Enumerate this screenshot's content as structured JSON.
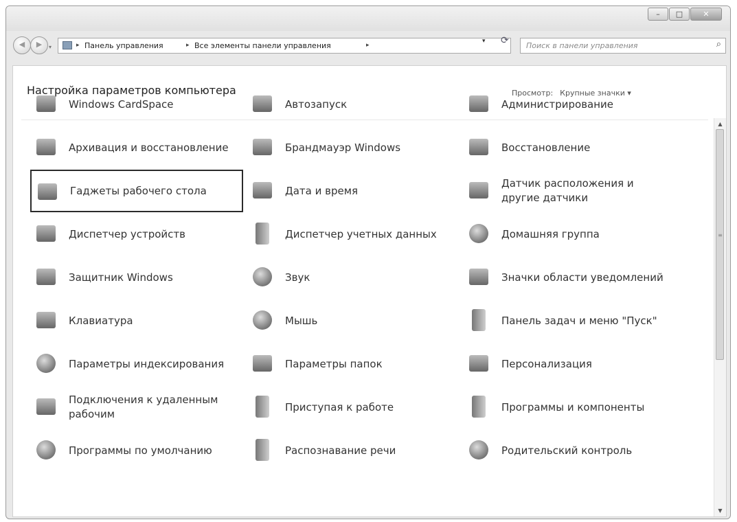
{
  "window": {
    "buttons": {
      "minimize": "–",
      "maximize": "□",
      "close": "✕"
    }
  },
  "nav": {
    "back_icon": "◀",
    "forward_icon": "▶",
    "dropdown_icon": "▾",
    "address": {
      "crumbs": [
        "Панель управления",
        "Все элементы панели управления"
      ],
      "separator": "▸",
      "dropdown_icon": "▾",
      "refresh_icon": "⟳"
    },
    "search": {
      "placeholder": "Поиск в панели управления",
      "icon": "⌕"
    }
  },
  "header": {
    "title": "Настройка параметров компьютера",
    "view_label": "Просмотр:",
    "view_value": "Крупные значки ▾"
  },
  "scrollbar": {
    "up": "▲",
    "down": "▼",
    "grip": "≡"
  },
  "items": [
    {
      "label": "Windows CardSpace",
      "icon": "cardspace-icon",
      "glyph": "sq"
    },
    {
      "label": "Автозапуск",
      "icon": "autoplay-icon",
      "glyph": "sq"
    },
    {
      "label": "Администрирование",
      "icon": "admin-tools-icon",
      "glyph": "sq"
    },
    {
      "label": "Архивация и восстановление",
      "icon": "backup-icon",
      "glyph": "sq"
    },
    {
      "label": "Брандмауэр Windows",
      "icon": "firewall-icon",
      "glyph": "sq"
    },
    {
      "label": "Восстановление",
      "icon": "recovery-icon",
      "glyph": "sq"
    },
    {
      "label": "Гаджеты рабочего стола",
      "icon": "gadgets-icon",
      "glyph": "sq",
      "selected": true
    },
    {
      "label": "Дата и время",
      "icon": "date-time-icon",
      "glyph": "sq"
    },
    {
      "label": "Датчик расположения и другие датчики",
      "icon": "sensors-icon",
      "glyph": "sq"
    },
    {
      "label": "Диспетчер устройств",
      "icon": "device-manager-icon",
      "glyph": "sq"
    },
    {
      "label": "Диспетчер учетных данных",
      "icon": "credential-manager-icon",
      "glyph": "tall"
    },
    {
      "label": "Домашняя группа",
      "icon": "homegroup-icon",
      "glyph": "rd"
    },
    {
      "label": "Защитник Windows",
      "icon": "defender-icon",
      "glyph": "sq"
    },
    {
      "label": "Звук",
      "icon": "sound-icon",
      "glyph": "rd"
    },
    {
      "label": "Значки области уведомлений",
      "icon": "notification-area-icon",
      "glyph": "sq"
    },
    {
      "label": "Клавиатура",
      "icon": "keyboard-icon",
      "glyph": "sq"
    },
    {
      "label": "Мышь",
      "icon": "mouse-icon",
      "glyph": "rd"
    },
    {
      "label": "Панель задач и меню \"Пуск\"",
      "icon": "taskbar-icon",
      "glyph": "tall"
    },
    {
      "label": "Параметры индексирования",
      "icon": "indexing-icon",
      "glyph": "rd"
    },
    {
      "label": "Параметры папок",
      "icon": "folder-options-icon",
      "glyph": "sq"
    },
    {
      "label": "Персонализация",
      "icon": "personalization-icon",
      "glyph": "sq"
    },
    {
      "label": "Подключения к удаленным рабочим",
      "icon": "remote-connections-icon",
      "glyph": "sq"
    },
    {
      "label": "Приступая к работе",
      "icon": "getting-started-icon",
      "glyph": "tall"
    },
    {
      "label": "Программы и компоненты",
      "icon": "programs-icon",
      "glyph": "tall"
    },
    {
      "label": "Программы по умолчанию",
      "icon": "default-programs-icon",
      "glyph": "rd"
    },
    {
      "label": "Распознавание речи",
      "icon": "speech-icon",
      "glyph": "tall"
    },
    {
      "label": "Родительский контроль",
      "icon": "parental-controls-icon",
      "glyph": "rd"
    }
  ]
}
